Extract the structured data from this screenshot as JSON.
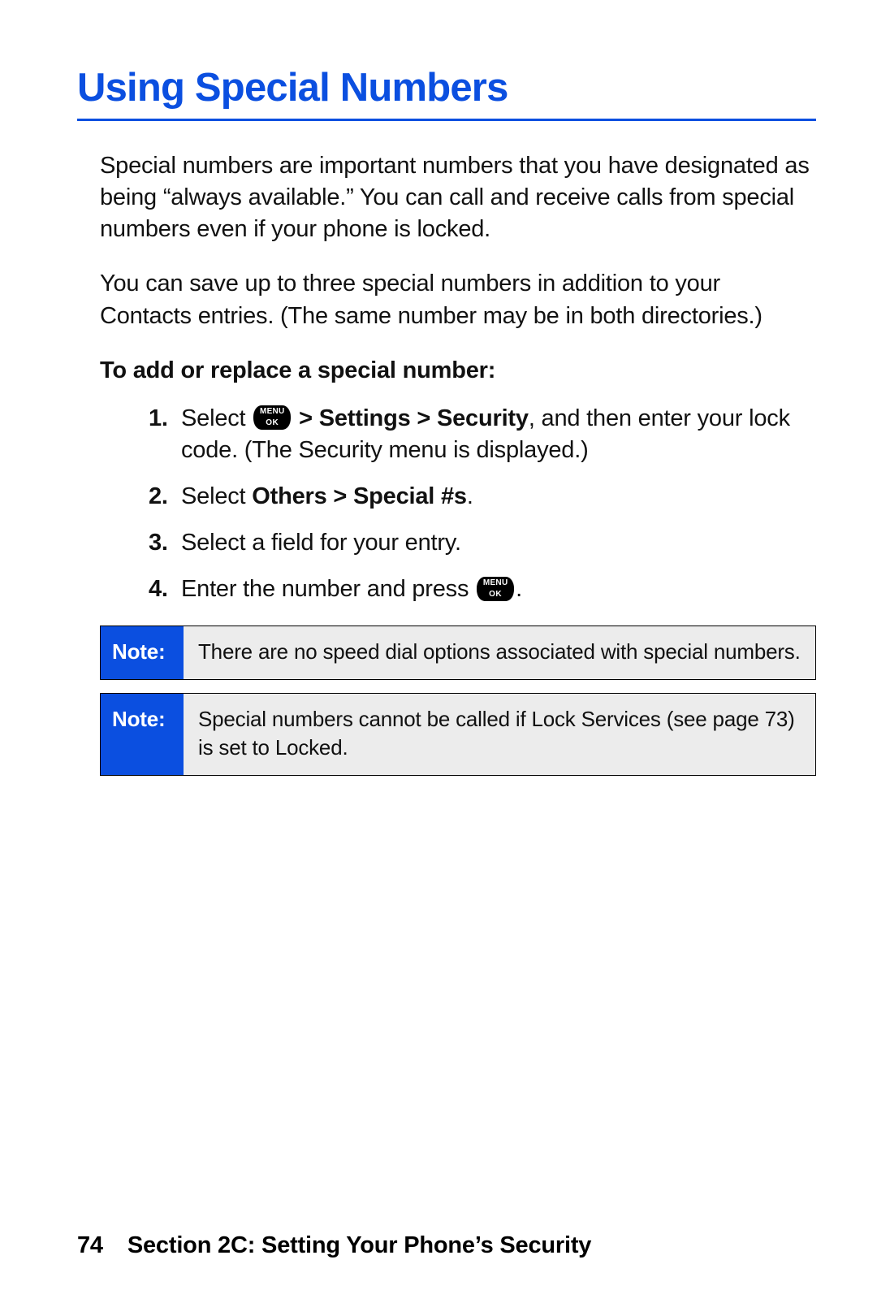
{
  "title": "Using Special Numbers",
  "paragraphs": {
    "p1": "Special numbers are important numbers that you have designated as being “always available.”  You can call and receive calls from special numbers even if your phone is locked.",
    "p2": "You can save up to three special numbers in addition to your Contacts entries. (The same number may be in both directories.)"
  },
  "subhead": "To add or replace a special number:",
  "steps": {
    "s1": {
      "num": "1.",
      "pre": "Select ",
      "nav": " > Settings > Security",
      "post": ", and then enter your lock code. (The Security menu is displayed.)"
    },
    "s2": {
      "num": "2.",
      "pre": "Select ",
      "bold": "Others > Special #s",
      "post": "."
    },
    "s3": {
      "num": "3.",
      "text": "Select a field for your entry."
    },
    "s4": {
      "num": "4.",
      "pre": "Enter the number and press ",
      "post": "."
    }
  },
  "icon": {
    "top": "MENU",
    "bottom": "OK"
  },
  "notes": {
    "label": "Note:",
    "n1": "There are no speed dial options associated with special numbers.",
    "n2": "Special numbers cannot be called if Lock Services (see page 73) is set to Locked."
  },
  "footer": {
    "page": "74",
    "section": "Section 2C: Setting Your Phone’s Security"
  }
}
